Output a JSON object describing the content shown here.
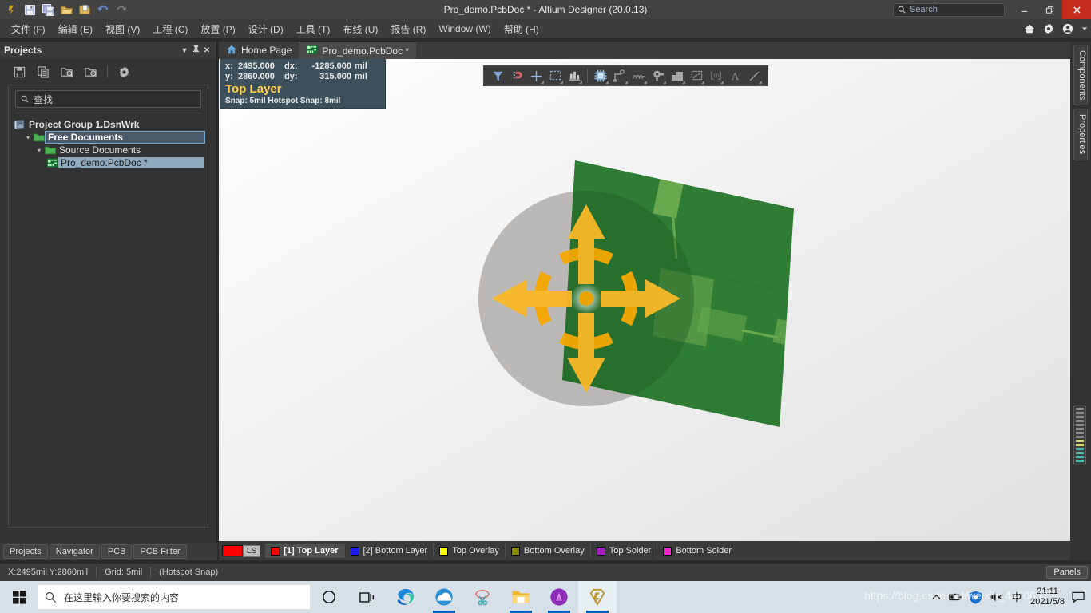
{
  "window": {
    "title": "Pro_demo.PcbDoc * - Altium Designer (20.0.13)",
    "search_placeholder": "Search",
    "minimize": "—",
    "restore": "❐",
    "close": "✕"
  },
  "quick_access": [
    {
      "name": "altium-logo-icon",
      "label": "A"
    },
    {
      "name": "save-icon",
      "label": "Save"
    },
    {
      "name": "save-all-icon",
      "label": "Save All"
    },
    {
      "name": "open-icon",
      "label": "Open"
    },
    {
      "name": "open-project-icon",
      "label": "Open Project"
    },
    {
      "name": "undo-icon",
      "label": "Undo"
    },
    {
      "name": "redo-icon",
      "label": "Redo"
    }
  ],
  "menubar": {
    "items": [
      {
        "label": "文件 (F)",
        "name": "menu-file"
      },
      {
        "label": "编辑 (E)",
        "name": "menu-edit"
      },
      {
        "label": "视图 (V)",
        "name": "menu-view"
      },
      {
        "label": "工程 (C)",
        "name": "menu-project"
      },
      {
        "label": "放置 (P)",
        "name": "menu-place"
      },
      {
        "label": "设计 (D)",
        "name": "menu-design"
      },
      {
        "label": "工具 (T)",
        "name": "menu-tools"
      },
      {
        "label": "布线 (U)",
        "name": "menu-route"
      },
      {
        "label": "报告 (R)",
        "name": "menu-reports"
      },
      {
        "label": "Window (W)",
        "name": "menu-window"
      },
      {
        "label": "帮助 (H)",
        "name": "menu-help"
      }
    ],
    "right_icons": [
      "home-icon",
      "gear-icon",
      "account-icon",
      "chevron-down-icon"
    ]
  },
  "projects_panel": {
    "title": "Projects",
    "header_buttons": [
      "chevron-down-icon",
      "pin-icon",
      "close-icon"
    ],
    "toolbar_icons": [
      "save-icon",
      "copy-icon",
      "search-folder-icon",
      "recent-folder-icon",
      "gear-icon"
    ],
    "find_placeholder": "查找",
    "tree": [
      {
        "label": "Project Group 1.DsnWrk",
        "level": 0,
        "icon": "workspace-icon",
        "state": "bold"
      },
      {
        "label": "Free Documents",
        "level": 1,
        "icon": "folder-icon",
        "state": "outlined"
      },
      {
        "label": "Source Documents",
        "level": 2,
        "icon": "folder-icon",
        "state": "normal"
      },
      {
        "label": "Pro_demo.PcbDoc *",
        "level": 3,
        "icon": "pcb-doc-icon",
        "state": "selected"
      }
    ],
    "bottom_tabs": [
      "Projects",
      "Navigator",
      "PCB",
      "PCB Filter"
    ]
  },
  "document_tabs": [
    {
      "label": "Home Page",
      "icon": "home-icon",
      "active": false
    },
    {
      "label": "Pro_demo.PcbDoc *",
      "icon": "pcb-doc-icon",
      "active": true
    }
  ],
  "hud": {
    "x_key": "x:",
    "x_value": "2495.000",
    "dx_key": "dx:",
    "dx_value": "-1285.000",
    "dx_unit": "mil",
    "y_key": "y:",
    "y_value": "2860.000",
    "dy_key": "dy:",
    "dy_value": "315.000",
    "dy_unit": "mil",
    "layer": "Top Layer",
    "snap": "Snap: 5mil Hotspot Snap: 8mil",
    "layer_color": "#ffd24a",
    "bg_color": "#3d4f5a"
  },
  "canvas_toolbar": {
    "icons": [
      {
        "name": "filter-icon",
        "dropdown": false
      },
      {
        "name": "magnet-snap-icon",
        "dropdown": false
      },
      {
        "name": "crosshair-icon",
        "dropdown": true
      },
      {
        "name": "marquee-select-icon",
        "dropdown": true
      },
      {
        "name": "align-icon",
        "dropdown": true
      },
      {
        "name": "component-icon",
        "dropdown": true
      },
      {
        "name": "route-track-icon",
        "dropdown": true
      },
      {
        "name": "interactive-length-tune-icon",
        "dropdown": true
      },
      {
        "name": "via-pad-icon",
        "dropdown": true
      },
      {
        "name": "polygon-pour-icon",
        "dropdown": true
      },
      {
        "name": "dimension-icon",
        "dropdown": true
      },
      {
        "name": "coordinate-icon",
        "dropdown": true
      },
      {
        "name": "text-string-icon",
        "dropdown": false
      },
      {
        "name": "line-icon",
        "dropdown": true
      }
    ]
  },
  "layer_bar": {
    "ls_label": "LS",
    "ls_color": "#ff0000",
    "layers": [
      {
        "label": "[1] Top Layer",
        "color": "#ff0000",
        "active": true
      },
      {
        "label": "[2] Bottom Layer",
        "color": "#1a1aff",
        "active": false
      },
      {
        "label": "Top Overlay",
        "color": "#ffff00",
        "active": false
      },
      {
        "label": "Bottom Overlay",
        "color": "#8b8b00",
        "active": false
      },
      {
        "label": "Top Solder",
        "color": "#a020c0",
        "active": false
      },
      {
        "label": "Bottom Solder",
        "color": "#ff22cc",
        "active": false
      }
    ]
  },
  "right_rail": {
    "tabs": [
      "Components",
      "Properties"
    ],
    "swatch_colors": [
      "#8d8d8d",
      "#8d8d8d",
      "#8d8d8d",
      "#8d8d8d",
      "#8d8d8d",
      "#8d8d8d",
      "#8d8d8d",
      "#8d8d8d",
      "#d8d860",
      "#d8d860",
      "#45c0b0",
      "#45c0b0",
      "#45c0b0",
      "#45c0b0"
    ]
  },
  "statusbar": {
    "coords": "X:2495mil Y:2860mil",
    "grid": "Grid: 5mil",
    "snap": "(Hotspot Snap)",
    "panels_button": "Panels"
  },
  "taskbar": {
    "start_icon": "windows-start-icon",
    "search_placeholder": "在这里输入你要搜索的内容",
    "icons": [
      {
        "name": "cortana-icon",
        "running": false,
        "active": false
      },
      {
        "name": "task-view-icon",
        "running": false,
        "active": false
      },
      {
        "name": "edge-browser-icon",
        "running": false,
        "active": false
      },
      {
        "name": "qq-browser-icon",
        "running": true,
        "active": false
      },
      {
        "name": "snipaste-icon",
        "running": false,
        "active": false
      },
      {
        "name": "file-explorer-icon",
        "running": true,
        "active": false
      },
      {
        "name": "app-purple-icon",
        "running": true,
        "active": false
      },
      {
        "name": "altium-designer-icon",
        "running": true,
        "active": true
      }
    ],
    "tray_icons": [
      "chevron-up-icon",
      "battery-icon",
      "security-shield-icon",
      "volume-muted-icon",
      "ime-chinese-icon",
      "notification-icon"
    ],
    "time": "21:11",
    "date": "2021/5/8"
  },
  "watermark": "https://blog.csdn.net/weixin_44606315",
  "pcb_view": {
    "board_color": "#2d7a31",
    "board_highlight": "#5fa34a",
    "shadow_color": "#b0b0b0",
    "compass_color": "#f5a800",
    "compass_center": "#f5a800"
  }
}
